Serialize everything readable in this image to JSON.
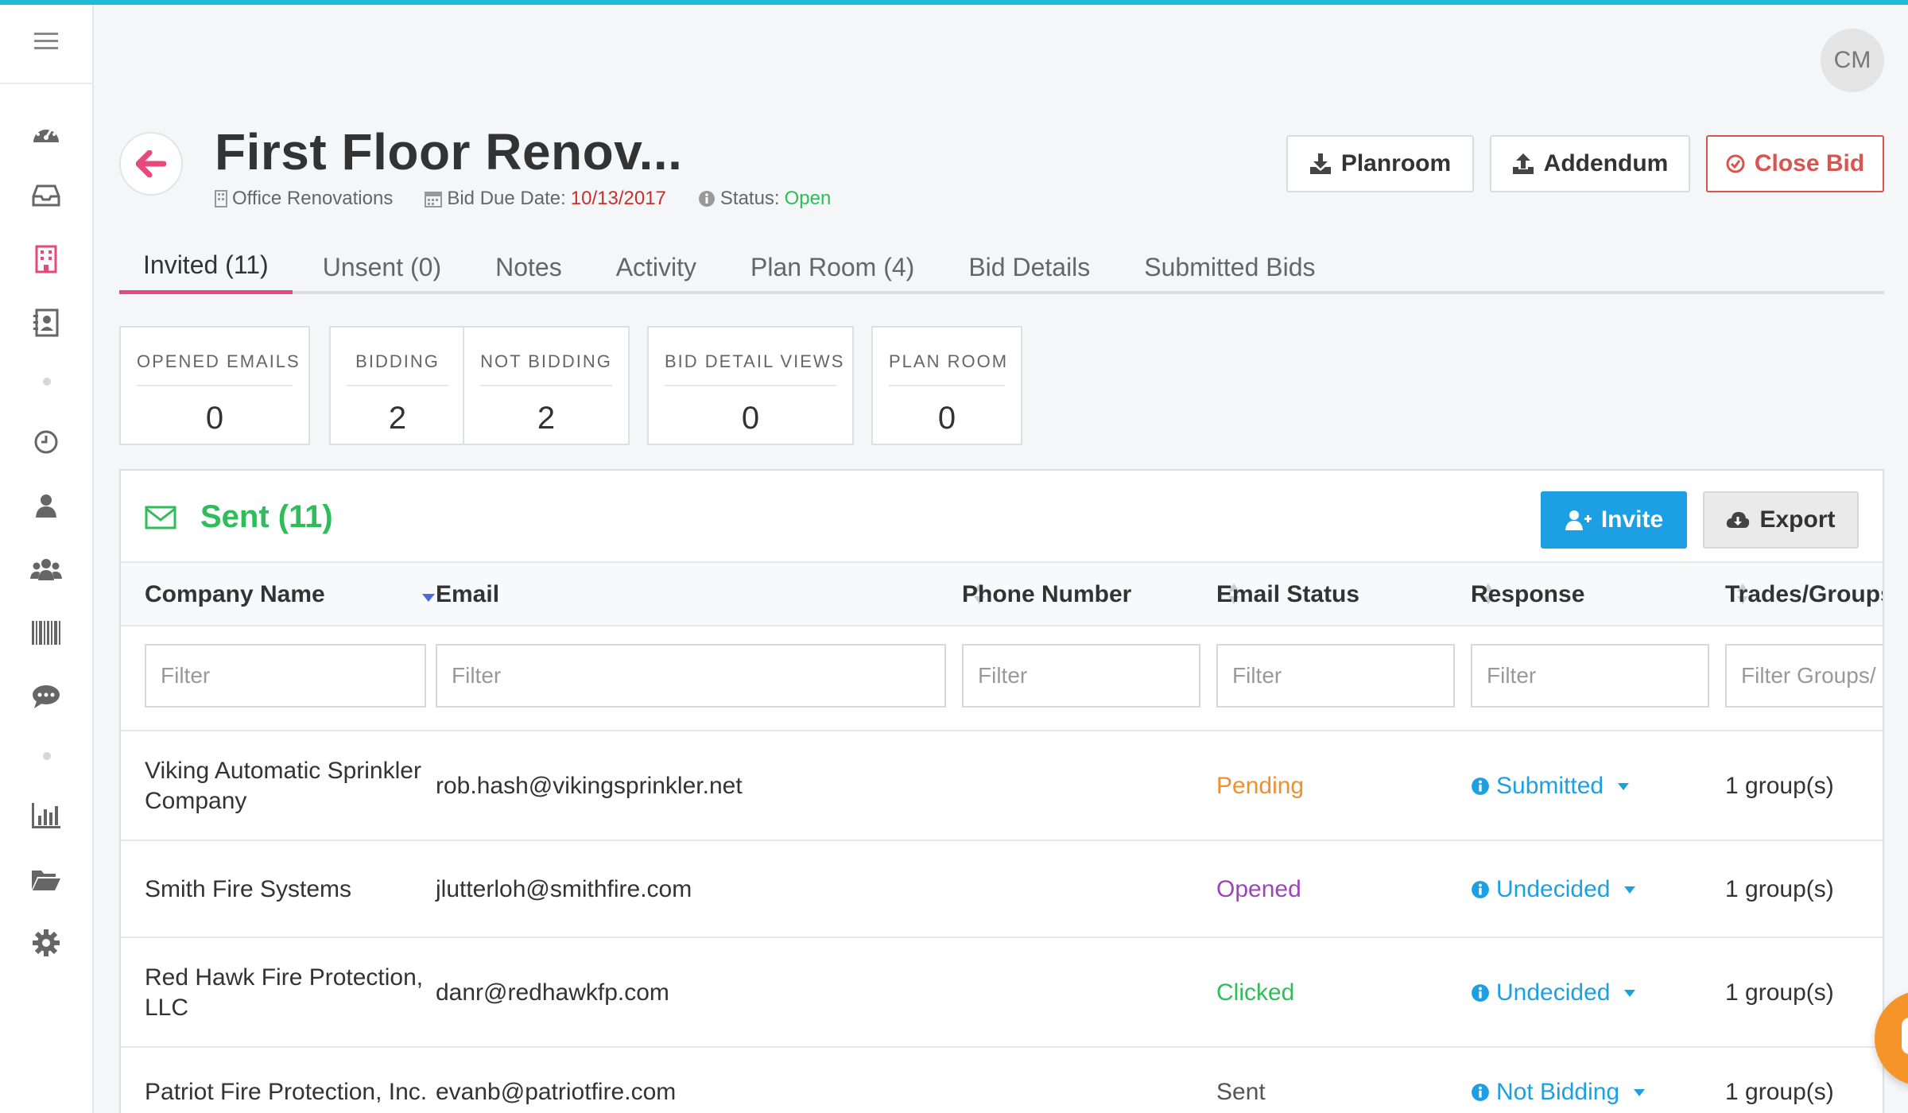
{
  "user": {
    "initials": "CM"
  },
  "project": {
    "title": "First Floor Renov...",
    "category": "Office Renovations",
    "due_label": "Bid Due Date:",
    "due_date": "10/13/2017",
    "status_label": "Status:",
    "status": "Open"
  },
  "header_buttons": {
    "planroom": "Planroom",
    "addendum": "Addendum",
    "close_bid": "Close Bid"
  },
  "tabs": [
    {
      "label": "Invited (11)",
      "active": true
    },
    {
      "label": "Unsent (0)"
    },
    {
      "label": "Notes"
    },
    {
      "label": "Activity"
    },
    {
      "label": "Plan Room (4)"
    },
    {
      "label": "Bid Details"
    },
    {
      "label": "Submitted Bids"
    }
  ],
  "stats": [
    {
      "label": "OPENED EMAILS",
      "value": "0"
    },
    {
      "label": "BIDDING",
      "value": "2"
    },
    {
      "label": "NOT BIDDING",
      "value": "2"
    },
    {
      "label": "BID DETAIL VIEWS",
      "value": "0"
    },
    {
      "label": "PLAN ROOM",
      "value": "0"
    }
  ],
  "sent": {
    "title": "Sent (11)",
    "invite_label": "Invite",
    "export_label": "Export",
    "columns": [
      "Company Name",
      "Email",
      "Phone Number",
      "Email Status",
      "Response",
      "Trades/Groups"
    ],
    "filters": [
      "Filter",
      "Filter",
      "Filter",
      "Filter",
      "Filter",
      "Filter Groups/"
    ],
    "rows": [
      {
        "company": "Viking Automatic Sprinkler Company",
        "email": "rob.hash@vikingsprinkler.net",
        "phone": "",
        "email_status": "Pending",
        "response": "Submitted",
        "groups": "1 group(s)"
      },
      {
        "company": "Smith Fire Systems",
        "email": "jlutterloh@smithfire.com",
        "phone": "",
        "email_status": "Opened",
        "response": "Undecided",
        "groups": "1 group(s)"
      },
      {
        "company": "Red Hawk Fire Protection, LLC",
        "email": "danr@redhawkfp.com",
        "phone": "",
        "email_status": "Clicked",
        "response": "Undecided",
        "groups": "1 group(s)"
      },
      {
        "company": "Patriot Fire Protection, Inc.",
        "email": "evanb@patriotfire.com",
        "phone": "",
        "email_status": "Sent",
        "response": "Not Bidding",
        "groups": "1 group(s)"
      }
    ]
  },
  "colors": {
    "accent_top": "#1fbad6",
    "tab_active": "#e6497a",
    "green": "#2ebd59",
    "blue": "#1d9fe3",
    "red": "#d9534f",
    "pending": "#f0902a",
    "opened": "#9b45b8",
    "chat": "#f59429"
  }
}
